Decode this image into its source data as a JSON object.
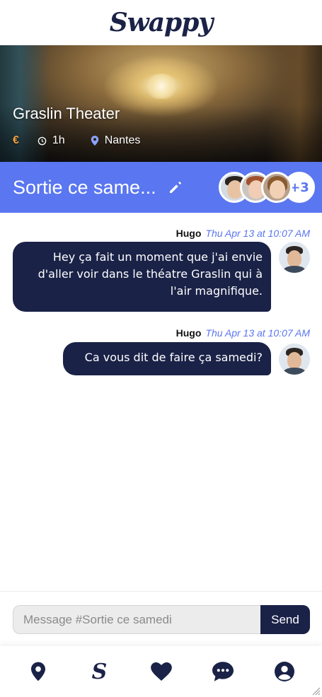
{
  "app": {
    "logo_text": "Swappy"
  },
  "activity": {
    "title": "Graslin Theater",
    "price_symbol": "€",
    "duration": "1h",
    "location": "Nantes"
  },
  "group": {
    "name": "Sortie ce same...",
    "extra_members": "+3",
    "accent_color": "#5a76f0"
  },
  "messages": [
    {
      "author": "Hugo",
      "time": "Thu Apr 13 at 10:07 AM",
      "lines": [
        "Hey ça fait un moment que j'ai envie",
        "d'aller voir dans le théatre Graslin qui à",
        "l'air magnifique."
      ]
    },
    {
      "author": "Hugo",
      "time": "Thu Apr 13 at 10:07 AM",
      "lines": [
        "Ca vous dit de faire ça samedi?"
      ]
    }
  ],
  "composer": {
    "placeholder": "Message #Sortie ce samedi",
    "send_label": "Send"
  },
  "tabbar": {
    "items": [
      "location-pin-icon",
      "swappy-s-icon",
      "heart-icon",
      "chat-bubble-icon",
      "user-circle-icon"
    ]
  },
  "colors": {
    "navy": "#1a2247",
    "price": "#f0a13a"
  }
}
